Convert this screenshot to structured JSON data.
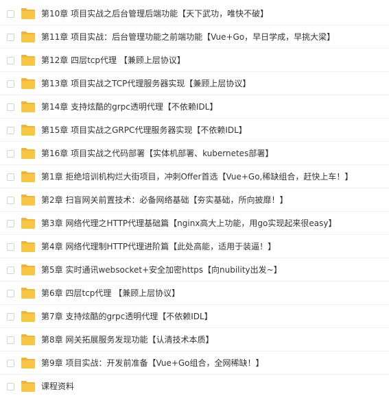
{
  "folder_icon": "folder-icon",
  "colors": {
    "folder": "#f8c545",
    "folder_tab": "#f0b332",
    "text": "#333333",
    "checkbox_border": "#cfd4da"
  },
  "files": [
    {
      "name": "第10章 项目实战之后台管理后端功能【天下武功，唯快不破】"
    },
    {
      "name": "第11章 项目实战：后台管理功能之前端功能【Vue+Go，早日学成，早挑大梁】"
    },
    {
      "name": "第12章 四层tcp代理 【兼顾上层协议】"
    },
    {
      "name": "第13章 项目实战之TCP代理服务器实现【兼顾上层协议】"
    },
    {
      "name": "第14章 支持炫酷的grpc透明代理【不依赖IDL】"
    },
    {
      "name": "第15章 项目实战之GRPC代理服务器实现【不依赖IDL】"
    },
    {
      "name": "第16章 项目实战之代码部署【实体机部署、kubernetes部署】"
    },
    {
      "name": "第1章 拒绝培训机构烂大街项目，冲刺Offer首选【Vue+Go,稀缺组合，赶快上车！】"
    },
    {
      "name": "第2章 扫盲网关前置技术：必备网络基础【夯实基础，所向披靡！】"
    },
    {
      "name": "第3章 网络代理之HTTP代理基础篇【nginx高大上功能，用go实现起来很easy】"
    },
    {
      "name": "第4章 网络代理制HTTP代理进阶篇【此处高能，适用于装逼！】"
    },
    {
      "name": "第5章 实时通讯websocket+安全加密https【向nubility出发~】"
    },
    {
      "name": "第6章 四层tcp代理 【兼顾上层协议】"
    },
    {
      "name": "第7章 支持炫酷的grpc透明代理【不依赖IDL】"
    },
    {
      "name": "第8章 网关拓展服务发现功能【认清技术本质】"
    },
    {
      "name": "第9章 项目实战：开发前准备【Vue+Go组合，全网稀缺！】"
    },
    {
      "name": "课程资料"
    }
  ]
}
